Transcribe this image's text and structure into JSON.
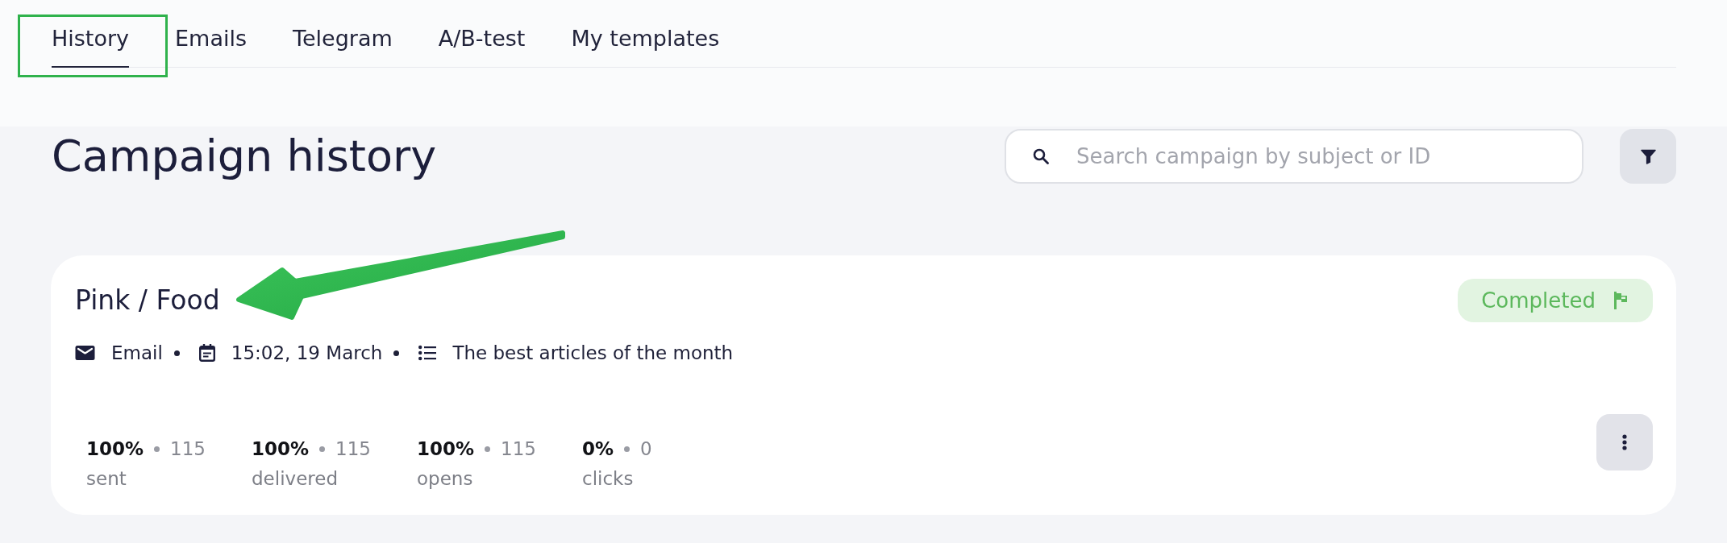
{
  "tabs": [
    {
      "label": "History",
      "selected": true
    },
    {
      "label": "Emails",
      "selected": false
    },
    {
      "label": "Telegram",
      "selected": false
    },
    {
      "label": "A/B-test",
      "selected": false
    },
    {
      "label": "My templates",
      "selected": false
    }
  ],
  "page": {
    "title": "Campaign history"
  },
  "search": {
    "placeholder": "Search campaign by subject or ID"
  },
  "campaign": {
    "name": "Pink / Food",
    "status": "Completed",
    "meta": [
      {
        "kind": "channel",
        "text": "Email"
      },
      {
        "kind": "date",
        "text": "15:02, 19 March"
      },
      {
        "kind": "list",
        "text": "The best articles of the month"
      }
    ],
    "stats": [
      {
        "percent": "100%",
        "count": "115",
        "label": "sent"
      },
      {
        "percent": "100%",
        "count": "115",
        "label": "delivered"
      },
      {
        "percent": "100%",
        "count": "115",
        "label": "opens"
      },
      {
        "percent": "0%",
        "count": "0",
        "label": "clicks"
      }
    ]
  }
}
